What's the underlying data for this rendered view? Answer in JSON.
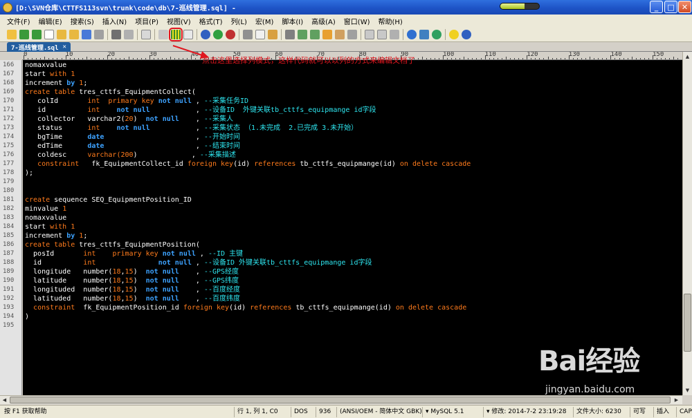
{
  "window": {
    "title": "[D:\\SVN仓库\\CTTFS113svn\\trunk\\code\\db\\7-巡线管理.sql] -",
    "progress_fraction": 0.62,
    "minimize_label": "_",
    "maximize_label": "□",
    "close_label": "✕"
  },
  "menu": [
    "文件(F)",
    "编辑(E)",
    "搜索(S)",
    "插入(N)",
    "项目(P)",
    "视图(V)",
    "格式(T)",
    "列(L)",
    "宏(M)",
    "脚本(I)",
    "高级(A)",
    "窗口(W)",
    "帮助(H)"
  ],
  "tab": {
    "label": "7-巡线管理.sql",
    "close": "✕"
  },
  "annotation": "点击这里选择列模式，这样代码就可以以列的方式来编辑文档了",
  "ruler_numbers": [
    "0",
    "10",
    "20",
    "30",
    "40",
    "50",
    "60",
    "70",
    "80",
    "90",
    "100",
    "110",
    "120",
    "130",
    "140",
    "150"
  ],
  "line_numbers": [
    "166",
    "167",
    "168",
    "169",
    "170",
    "171",
    "172",
    "173",
    "174",
    "175",
    "176",
    "177",
    "178",
    "179",
    "180",
    "181",
    "182",
    "183",
    "184",
    "185",
    "186",
    "187",
    "188",
    "189",
    "190",
    "191",
    "192",
    "193",
    "194",
    "195"
  ],
  "code": {
    "l166": "nomaxvalue",
    "l167_a": "start ",
    "l167_b": "with",
    "l167_c": " ",
    "l167_d": "1",
    "l168_a": "increment ",
    "l168_b": "by",
    "l168_c": " ",
    "l168_d": "1",
    "l168_e": ";",
    "l169_a": "create table",
    "l169_b": " tres_cttfs_EquipmentCollect(",
    "l170_a": "   colId       ",
    "l170_b": "int",
    "l170_c": "  ",
    "l170_d": "primary key",
    "l170_e": " ",
    "l170_f": "not null",
    "l170_g": " , ",
    "l170_h": "--采集任务ID",
    "l171_a": "   id          ",
    "l171_b": "int",
    "l171_c": "    ",
    "l171_d": "not null",
    "l171_e": "           , ",
    "l171_f": "--设备ID  外键关联tb_cttfs_equipmange id字段",
    "l172_a": "   collector   varchar2(",
    "l172_b": "20",
    "l172_c": ")  ",
    "l172_d": "not null",
    "l172_e": "    , ",
    "l172_f": "--采集人",
    "l173_a": "   status      ",
    "l173_b": "int",
    "l173_c": "    ",
    "l173_d": "not null",
    "l173_e": "           , ",
    "l173_f": "--采集状态 （1.未完成  2.已完成 3.未开始）",
    "l174_a": "   bgTime      ",
    "l174_b": "date",
    "l174_c": "                      , ",
    "l174_d": "--开始时间",
    "l175_a": "   edTime      ",
    "l175_b": "date",
    "l175_c": "                      , ",
    "l175_d": "--结束时间",
    "l176_a": "   coldesc     ",
    "l176_b": "varchar(",
    "l176_c": "200",
    "l176_d": ")             , ",
    "l176_e": "--采集描述",
    "l177_a": "   ",
    "l177_b": "constraint",
    "l177_c": "   fk_EquipmentCollect_id ",
    "l177_d": "foreign key",
    "l177_e": "(id) ",
    "l177_f": "references",
    "l177_g": " tb_cttfs_equipmange(id) ",
    "l177_h": "on delete cascade",
    "l178": ");",
    "l181_a": "create",
    "l181_b": " sequence SEQ_EquipmentPosition_ID",
    "l182_a": "minvalue ",
    "l182_b": "1",
    "l183": "nomaxvalue",
    "l184_a": "start ",
    "l184_b": "with",
    "l184_c": " ",
    "l184_d": "1",
    "l185_a": "increment ",
    "l185_b": "by",
    "l185_c": " ",
    "l185_d": "1",
    "l185_e": ";",
    "l186_a": "create table",
    "l186_b": " tres_cttfs_EquipmentPosition(",
    "l187_a": "  posId       ",
    "l187_b": "int",
    "l187_c": "    ",
    "l187_d": "primary key",
    "l187_e": " ",
    "l187_f": "not null",
    "l187_g": " , ",
    "l187_h": "--ID 主键",
    "l188_a": "  id          ",
    "l188_b": "int",
    "l188_c": "               ",
    "l188_d": "not null",
    "l188_e": " , ",
    "l188_f": "--设备ID 外键关联tb_cttfs_equipmange id字段",
    "l189_a": "  longitude   number(",
    "l189_b": "18",
    "l189_c": ",",
    "l189_d": "15",
    "l189_e": ")  ",
    "l189_f": "not null",
    "l189_g": "    , ",
    "l189_h": "--GPS经度",
    "l190_a": "  latitude    number(",
    "l190_b": "18",
    "l190_c": ",",
    "l190_d": "15",
    "l190_e": ")  ",
    "l190_f": "not null",
    "l190_g": "    , ",
    "l190_h": "--GPS纬度",
    "l191_a": "  longituded  number(",
    "l191_b": "18",
    "l191_c": ",",
    "l191_d": "15",
    "l191_e": ")  ",
    "l191_f": "not null",
    "l191_g": "    , ",
    "l191_h": "--百度经度",
    "l192_a": "  latituded   number(",
    "l192_b": "18",
    "l192_c": ",",
    "l192_d": "15",
    "l192_e": ")  ",
    "l192_f": "not null",
    "l192_g": "    , ",
    "l192_h": "--百度纬度",
    "l193_a": "  ",
    "l193_b": "constraint",
    "l193_c": "  fk_EquipmentPosition_id ",
    "l193_d": "foreign key",
    "l193_e": "(id) ",
    "l193_f": "references",
    "l193_g": " tb_cttfs_equipmange(id) ",
    "l193_h": "on delete cascade",
    "l194": ")"
  },
  "status": {
    "help": "按 F1 获取帮助",
    "position": "行 1, 列 1, C0",
    "line_ending": "DOS",
    "codepage": "936",
    "encoding": "(ANSI/OEM - 简体中文 GBK)",
    "syntax": "MySQL 5.1",
    "modified": "修改:  2014-7-2 23:19:28",
    "file_size": "文件大小: 6230",
    "writable": "可写",
    "insert_mode": "插入",
    "caps": "CAP"
  },
  "watermark": {
    "main": "Bai经验",
    "sub": "jingyan.baidu.com"
  },
  "colors": {
    "keyword": "#ff7b1c",
    "type": "#3da2ff",
    "comment": "#2ee6f0",
    "editor_bg": "#000000",
    "annotation": "#e0161e"
  }
}
